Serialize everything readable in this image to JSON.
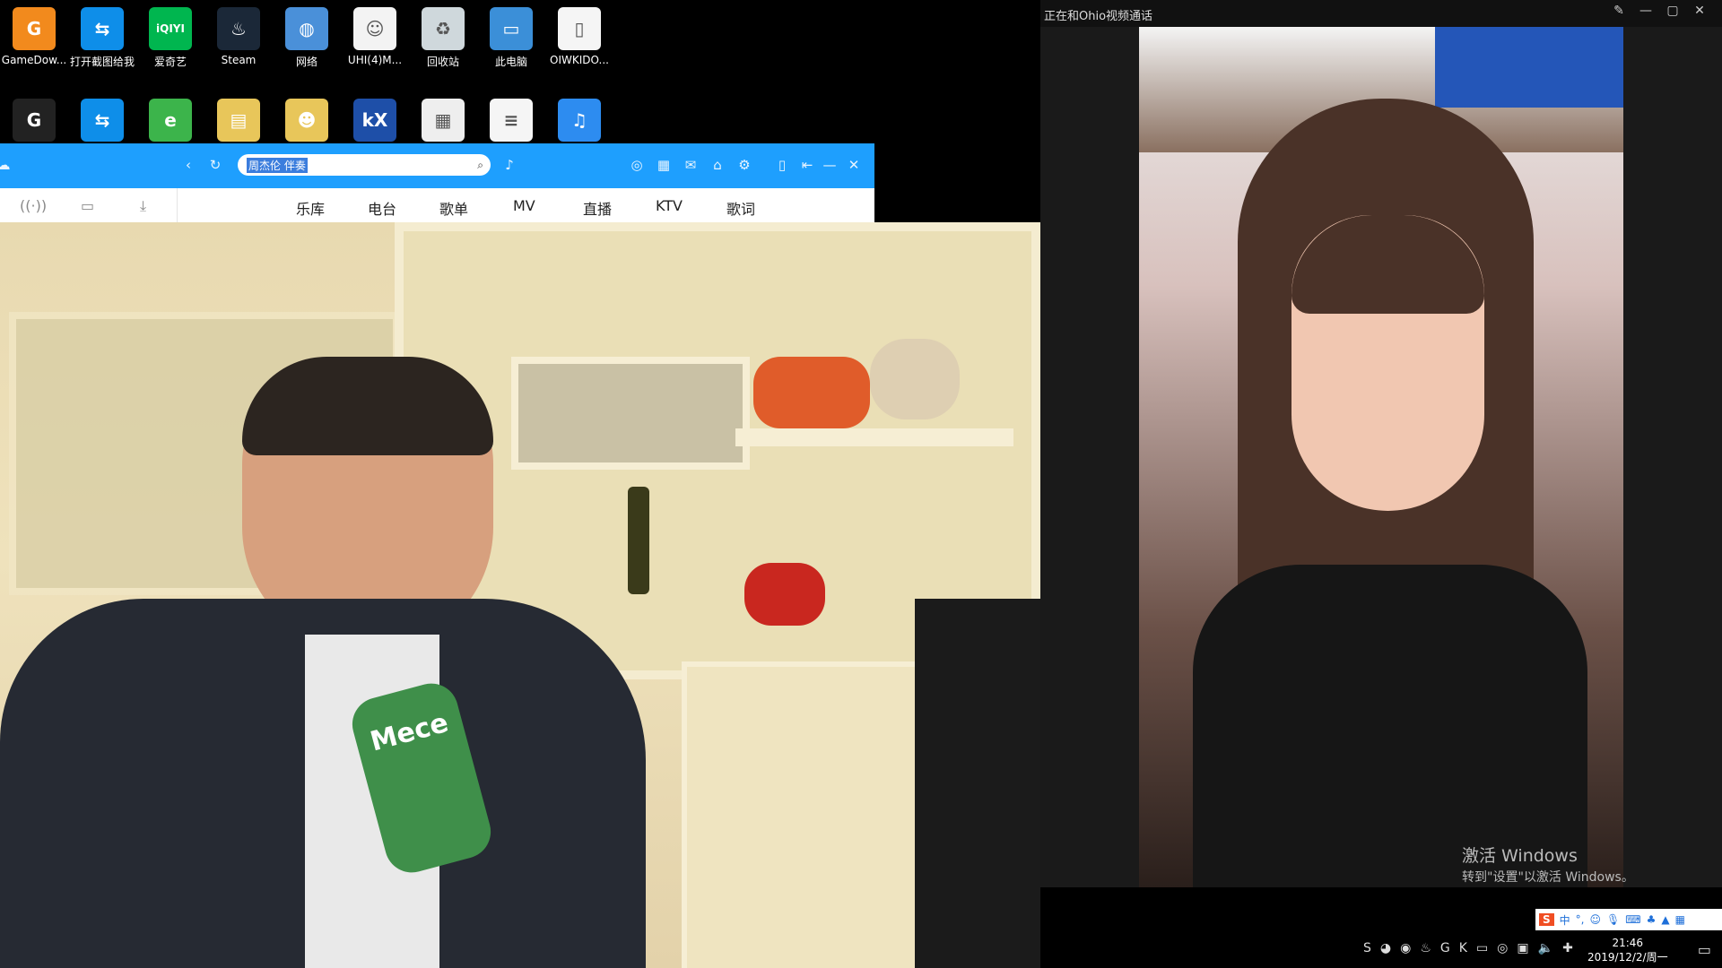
{
  "desktop": {
    "row1": [
      {
        "label": "GameDow...",
        "icon": "gamedownload-icon",
        "color": "#f28a1d",
        "glyph": "G"
      },
      {
        "label": "打开截图给我",
        "icon": "teamviewer-icon",
        "color": "#0e8ee9",
        "glyph": "⇆"
      },
      {
        "label": "爱奇艺",
        "icon": "iqiyi-icon",
        "color": "#00b64f",
        "glyph": "iQIYI"
      },
      {
        "label": "Steam",
        "icon": "steam-icon",
        "color": "#1b2838",
        "glyph": "♨"
      },
      {
        "label": "网络",
        "icon": "network-icon",
        "color": "#4a90d9",
        "glyph": "◍"
      },
      {
        "label": "UHI(4)M...",
        "icon": "image-file-icon",
        "color": "#f3f3f3",
        "glyph": "☺"
      },
      {
        "label": "回收站",
        "icon": "recycle-bin-icon",
        "color": "#cfd8dc",
        "glyph": "♻"
      },
      {
        "label": "此电脑",
        "icon": "this-pc-icon",
        "color": "#3b8fd8",
        "glyph": "▭"
      },
      {
        "label": "OIWKIDO...",
        "icon": "document-icon",
        "color": "#f5f5f5",
        "glyph": "▯"
      }
    ],
    "row2": [
      {
        "icon": "gameapp-icon",
        "color": "#222",
        "glyph": "G"
      },
      {
        "icon": "teamviewer-icon",
        "color": "#0e8ee9",
        "glyph": "⇆"
      },
      {
        "icon": "ie-browser-icon",
        "color": "#3cb44b",
        "glyph": "e"
      },
      {
        "icon": "folder-icon",
        "color": "#e8c65a",
        "glyph": "▤"
      },
      {
        "icon": "user-folder-icon",
        "color": "#e8c65a",
        "glyph": "☻"
      },
      {
        "icon": "kx-app-icon",
        "color": "#1e4fa8",
        "glyph": "kX"
      },
      {
        "icon": "qr-image-icon",
        "color": "#eeeeee",
        "glyph": "▦"
      },
      {
        "icon": "text-file-icon",
        "color": "#f5f5f5",
        "glyph": "≡"
      },
      {
        "icon": "mp3-file-icon",
        "color": "#2d8cf0",
        "glyph": "♫"
      }
    ]
  },
  "player": {
    "search_text": "周杰伦 伴奏",
    "tabs": [
      "乐库",
      "电台",
      "歌单",
      "MV",
      "直播",
      "KTV",
      "歌词"
    ]
  },
  "call": {
    "title": "正在和Ohio视频通话"
  },
  "activation": {
    "line1": "激活 Windows",
    "line2": "转到\"设置\"以激活 Windows。"
  },
  "tray": {
    "time": "21:46",
    "date": "2019/12/2/周一",
    "ime": "中"
  },
  "cam": {
    "can_text": "Mece"
  }
}
